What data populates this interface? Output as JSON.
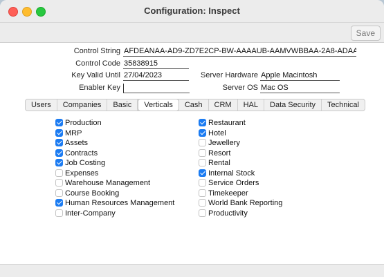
{
  "window": {
    "title": "Configuration: Inspect"
  },
  "toolbar": {
    "save_label": "Save"
  },
  "fields": {
    "control_string": {
      "label": "Control String",
      "value": "AFDEANAA-AD9-ZD7E2CP-BW-AAAAUB-AAMVWBBAA-2A8-ADAA..."
    },
    "control_code": {
      "label": "Control Code",
      "value": "35838915"
    },
    "key_valid_until": {
      "label": "Key Valid Until",
      "value": "27/04/2023"
    },
    "enabler_key": {
      "label": "Enabler Key",
      "value": ""
    },
    "server_hardware": {
      "label": "Server Hardware",
      "value": "Apple Macintosh"
    },
    "server_os": {
      "label": "Server OS",
      "value": "Mac OS"
    }
  },
  "tabs": [
    {
      "label": "Users",
      "active": false
    },
    {
      "label": "Companies",
      "active": false
    },
    {
      "label": "Basic",
      "active": false
    },
    {
      "label": "Verticals",
      "active": true
    },
    {
      "label": "Cash",
      "active": false
    },
    {
      "label": "CRM",
      "active": false
    },
    {
      "label": "HAL",
      "active": false
    },
    {
      "label": "Data Security",
      "active": false
    },
    {
      "label": "Technical",
      "active": false
    }
  ],
  "verticals_left": [
    {
      "label": "Production",
      "checked": true
    },
    {
      "label": "MRP",
      "checked": true
    },
    {
      "label": "Assets",
      "checked": true
    },
    {
      "label": "Contracts",
      "checked": true
    },
    {
      "label": "Job Costing",
      "checked": true
    },
    {
      "label": "Expenses",
      "checked": false
    },
    {
      "label": "Warehouse Management",
      "checked": false
    },
    {
      "label": "Course Booking",
      "checked": false
    },
    {
      "label": "Human Resources Management",
      "checked": true
    },
    {
      "label": "Inter-Company",
      "checked": false
    }
  ],
  "verticals_right": [
    {
      "label": "Restaurant",
      "checked": true
    },
    {
      "label": "Hotel",
      "checked": true
    },
    {
      "label": "Jewellery",
      "checked": false
    },
    {
      "label": "Resort",
      "checked": false
    },
    {
      "label": "Rental",
      "checked": false
    },
    {
      "label": "Internal Stock",
      "checked": true
    },
    {
      "label": "Service Orders",
      "checked": false
    },
    {
      "label": "Timekeeper",
      "checked": false
    },
    {
      "label": "World Bank Reporting",
      "checked": false
    },
    {
      "label": "Productivity",
      "checked": false
    }
  ]
}
